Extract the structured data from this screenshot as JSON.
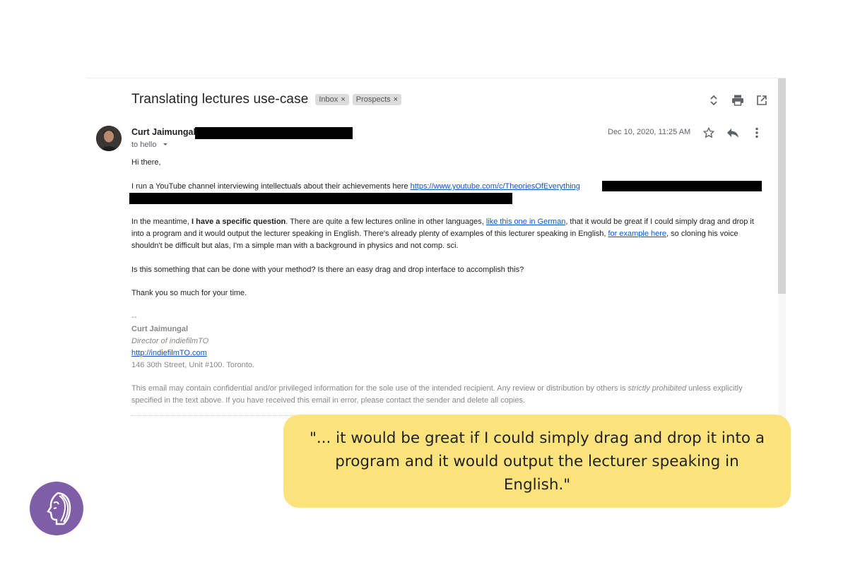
{
  "email": {
    "subject": "Translating lectures use-case",
    "labels": [
      {
        "name": "Inbox",
        "remove": "×"
      },
      {
        "name": "Prospects",
        "remove": "×"
      }
    ],
    "sender_name": "Curt Jaimungal",
    "to_line": "to hello",
    "date": "Dec 10, 2020, 11:25 AM",
    "body": {
      "greeting": "Hi there,",
      "p1_text": "I run a YouTube channel interviewing intellectuals about their achievements here ",
      "p1_link": "https://www.youtube.com/c/TheoriesOfEverything",
      "p2_a": "In the meantime, ",
      "p2_bold": "I have a specific question",
      "p2_b": ". There are quite a few lectures online in other languages, ",
      "p2_link1": "like this one in German",
      "p2_c": ", that it would be great if I could simply drag and drop it into a program and it would output the lecturer speaking in English. There's already plenty of examples of this lecturer speaking in English, ",
      "p2_link2": "for example here",
      "p2_d": ", so cloning his voice shouldn't be difficult but alas, I'm a simple man with a background in physics and not comp. sci.",
      "p3": "Is this something that can be done with your method? Is there an easy drag and drop interface to accomplish this?",
      "p4": "Thank you so much for your time."
    },
    "signature": {
      "dash": "--",
      "name": "Curt Jaimungal",
      "title": "Director of indiefilmTO",
      "link": "http://indiefilmTO.com",
      "address": "146 30th Street, Unit #100. Toronto."
    },
    "disclaimer": {
      "a": "This email may contain confidential and/or privileged information for the sole use of the intended recipient. Any review or distribution by others is ",
      "em": "strictly prohibited",
      "b": " unless explicitly specified in the text above. If you have received this email in error, please contact the sender and delete all copies."
    }
  },
  "callout": {
    "quote": "\"... it would be great if I could simply drag and drop it into a program and it would output the lecturer speaking in English.\""
  },
  "icons": {
    "expand": "expand-collapse-icon",
    "print": "print-icon",
    "open_new": "open-in-new-window-icon",
    "star": "star-icon",
    "reply": "reply-icon",
    "more": "more-vertical-icon",
    "dropdown": "dropdown-arrow-icon",
    "logo": "face-logo-icon"
  },
  "colors": {
    "link": "#1155cc",
    "callout_bg": "#fde37b",
    "logo_bg": "#7e5ea6",
    "chip_bg": "#dcdcdc"
  }
}
